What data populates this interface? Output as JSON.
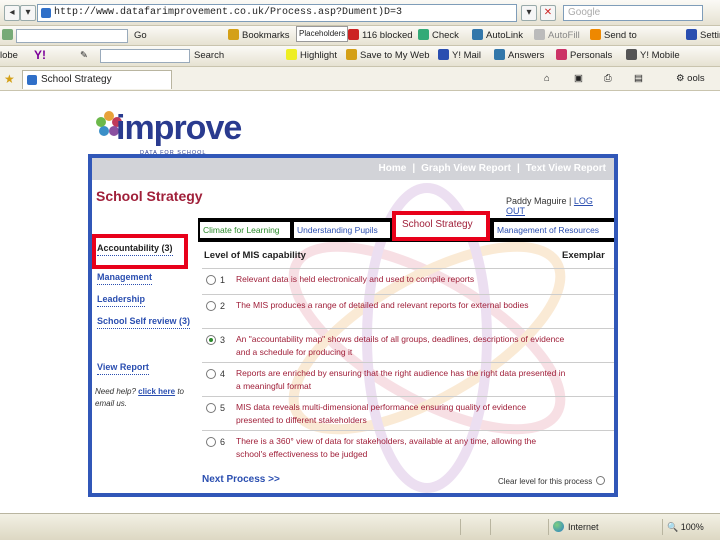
{
  "browser": {
    "url": "http://www.datafarimprovement.co.uk/Process.asp?Dument)D=3",
    "search_placeholder": "Google",
    "toolbar_row2": {
      "go_label": "Go",
      "bookmarks_label": "Bookmarks",
      "placeholder_popup": "Placeholders",
      "blocked_label": "116 blocked",
      "check_label": "Check",
      "autolink_label": "AutoLink",
      "autofill_label": "AutoFill",
      "send_to_label": "Send to",
      "settings_label": "Settin"
    },
    "toolbar_row3": {
      "left_label": "lobe",
      "yahoo_label": "Y!",
      "search_label": "Search",
      "highlight_label": "Highlight",
      "save_label": "Save to My Web",
      "mail_label": "Y! Mail",
      "answers_label": "Answers",
      "personals_label": "Personals",
      "mobile_label": "Y! Mobile"
    },
    "tab_title": "School Strategy",
    "tools_label": "ools",
    "status_zone": "Internet",
    "status_zoom": "100%"
  },
  "logo": {
    "word": "improve",
    "tagline": "DATA FOR SCHOOL IMPROVEMENT"
  },
  "app": {
    "nav": [
      "Home",
      "Graph View Report",
      "Text View Report"
    ],
    "title": "School Strategy",
    "user_name": "Paddy Maguire",
    "logout_label": "LOG OUT",
    "process_tabs": {
      "climate": "Climate for Learning",
      "pupils": "Understanding Pupils",
      "strategy": "School Strategy",
      "resources": "Management of Resources"
    },
    "sidebar": {
      "accountability": "Accountability (3)",
      "management": "Management",
      "leadership": "Leadership",
      "self_review": "School Self review (3)",
      "view_report": "View Report",
      "help_pre": "Need help?",
      "help_link": "click here",
      "help_post": "to email us."
    },
    "main_heading": "Level of MIS capability",
    "exemplar_heading": "Exemplar",
    "levels": [
      {
        "num": "1",
        "text": "Relevant data is held electronically and used to compile reports"
      },
      {
        "num": "2",
        "text": "The MIS produces a range of detailed and relevant reports for external bodies"
      },
      {
        "num": "3",
        "text": "An \"accountability map\" shows details of all groups, deadlines, descriptions of evidence and a schedule for producing it"
      },
      {
        "num": "4",
        "text": "Reports are enriched by ensuring that the right audience has the right data presented in a meaningful format"
      },
      {
        "num": "5",
        "text": "MIS data reveals multi-dimensional performance ensuring quality of evidence presented to different stakeholders"
      },
      {
        "num": "6",
        "text": "There is a 360° view of data for stakeholders, available at any time, allowing the school's effectiveness to be judged"
      }
    ],
    "selected_level": 3,
    "next_process_label": "Next Process >>",
    "clear_level_label": "Clear level for this process"
  }
}
